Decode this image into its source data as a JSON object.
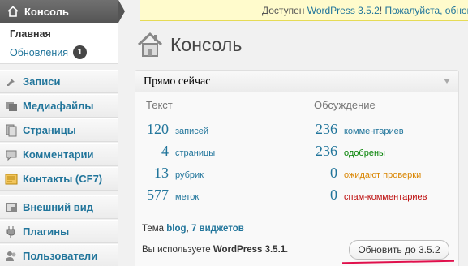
{
  "sidebar": {
    "dashboard_label": "Консоль",
    "submenu": {
      "main": "Главная",
      "updates": "Обновления",
      "updates_count": "1"
    },
    "items": [
      {
        "label": "Записи",
        "icon": "pin-icon"
      },
      {
        "label": "Медиафайлы",
        "icon": "media-icon"
      },
      {
        "label": "Страницы",
        "icon": "pages-icon"
      },
      {
        "label": "Комментарии",
        "icon": "comments-icon"
      },
      {
        "label": "Контакты (CF7)",
        "icon": "contact-form-icon"
      },
      {
        "label": "Внешний вид",
        "icon": "appearance-icon"
      },
      {
        "label": "Плагины",
        "icon": "plugins-icon"
      },
      {
        "label": "Пользователи",
        "icon": "users-icon"
      }
    ]
  },
  "update_nag": {
    "prefix": "Доступен ",
    "link": "WordPress 3.5.2",
    "middle": "! ",
    "action": "Пожалуйста, обнов"
  },
  "page": {
    "title": "Консоль"
  },
  "widget": {
    "title": "Прямо сейчас",
    "content_head": "Текст",
    "discussion_head": "Обсуждение",
    "content_rows": [
      {
        "num": "120",
        "label": "записей"
      },
      {
        "num": "4",
        "label": "страницы"
      },
      {
        "num": "13",
        "label": "рубрик"
      },
      {
        "num": "577",
        "label": "меток"
      }
    ],
    "discussion_rows": [
      {
        "num": "236",
        "label": "комментариев"
      },
      {
        "num": "236",
        "label": "одобрены"
      },
      {
        "num": "0",
        "label": "ожидают проверки"
      },
      {
        "num": "0",
        "label": "спам-комментариев"
      }
    ],
    "theme_prefix": "Тема ",
    "theme_name": "blog",
    "theme_sep": ", ",
    "widgets_count": "7 виджетов",
    "version_prefix": "Вы используете ",
    "version": "WordPress 3.5.1",
    "version_suffix": ".",
    "update_button": "Обновить до 3.5.2"
  },
  "colors": {
    "link": "#21759b",
    "approved": "#008000",
    "pending": "#d98500",
    "spam": "#bc0b0b",
    "highlight_underline": "#e0104c"
  }
}
